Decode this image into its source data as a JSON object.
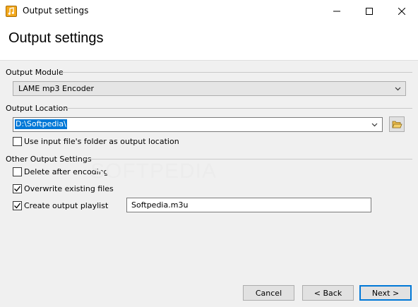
{
  "window": {
    "title": "Output settings"
  },
  "header": {
    "title": "Output settings"
  },
  "output_module": {
    "label": "Output Module",
    "selected": "LAME mp3 Encoder"
  },
  "output_location": {
    "label": "Output Location",
    "value": "D:\\Softpedia\\",
    "use_input_folder": {
      "label": "Use input file's folder as output location",
      "checked": false
    }
  },
  "other_settings": {
    "label": "Other Output Settings",
    "delete_after_encoding": {
      "label": "Delete after encoding",
      "checked": false
    },
    "overwrite_existing": {
      "label": "Overwrite existing files",
      "checked": true
    },
    "create_playlist": {
      "label": "Create output playlist",
      "checked": true
    },
    "playlist_name": "Softpedia.m3u"
  },
  "footer": {
    "cancel": "Cancel",
    "back": "< Back",
    "next": "Next >"
  },
  "watermark": "SOFTPEDIA"
}
